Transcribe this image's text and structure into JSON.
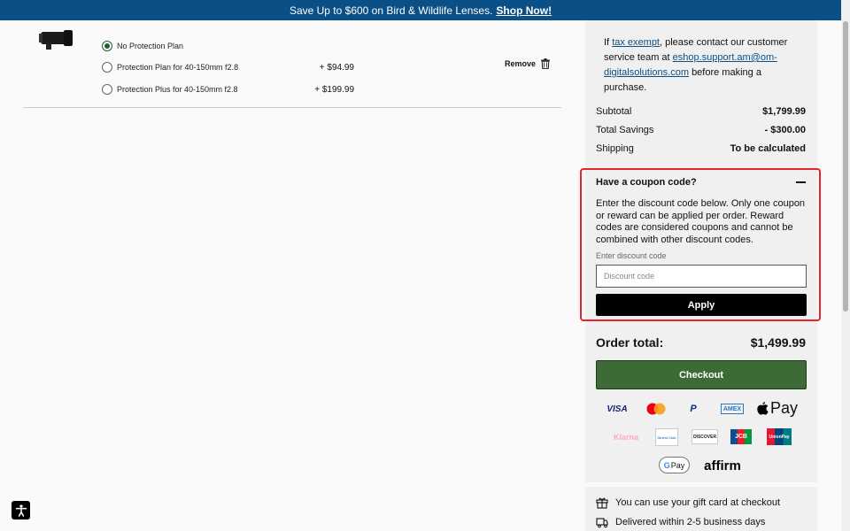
{
  "banner": {
    "text": "Save Up to $600 on Bird & Wildlife Lenses.",
    "link": "Shop Now!"
  },
  "product": {
    "options": [
      {
        "label": "No Protection Plan",
        "price": "",
        "selected": true
      },
      {
        "label": "Protection Plan for 40-150mm f2.8",
        "price": "+ $94.99",
        "selected": false
      },
      {
        "label": "Protection Plus for 40-150mm f2.8",
        "price": "+ $199.99",
        "selected": false
      }
    ],
    "remove_label": "Remove"
  },
  "summary": {
    "tax_prefix": "If",
    "tax_link": "tax exempt",
    "tax_mid": ", please contact our customer service team at",
    "tax_email": "eshop.support.am@om-digitalsolutions.com",
    "tax_suffix": "before making a purchase.",
    "subtotal_label": "Subtotal",
    "subtotal_value": "$1,799.99",
    "savings_label": "Total Savings",
    "savings_value": "- $300.00",
    "shipping_label": "Shipping",
    "shipping_value": "To be calculated",
    "coupon_title": "Have a coupon code?",
    "coupon_desc": "Enter the discount code below. Only one coupon or reward can be applied per order. Reward codes are considered coupons and cannot be combined with other discount codes.",
    "discount_label": "Enter discount code",
    "discount_placeholder": "Discount code",
    "apply_label": "Apply",
    "order_total_label": "Order total:",
    "order_total_value": "$1,499.99",
    "checkout_label": "Checkout",
    "payments": {
      "visa": "VISA",
      "mastercard": "mastercard-icon",
      "paypal": "P",
      "amex": "AMEX",
      "applepay": "Pay",
      "klarna": "Klarna",
      "diners": "Diners Club",
      "discover": "DISCOVER",
      "jcb": "JCB",
      "unionpay": "UnionPay",
      "gpay": "Pay",
      "affirm": "affirm"
    },
    "gift_text": "You can use your gift card at checkout",
    "delivery_text": "Delivered within 2-5 business days"
  },
  "colors": {
    "banner": "#0a4f85",
    "checkout": "#3d6b35",
    "highlight": "#e3242b"
  }
}
